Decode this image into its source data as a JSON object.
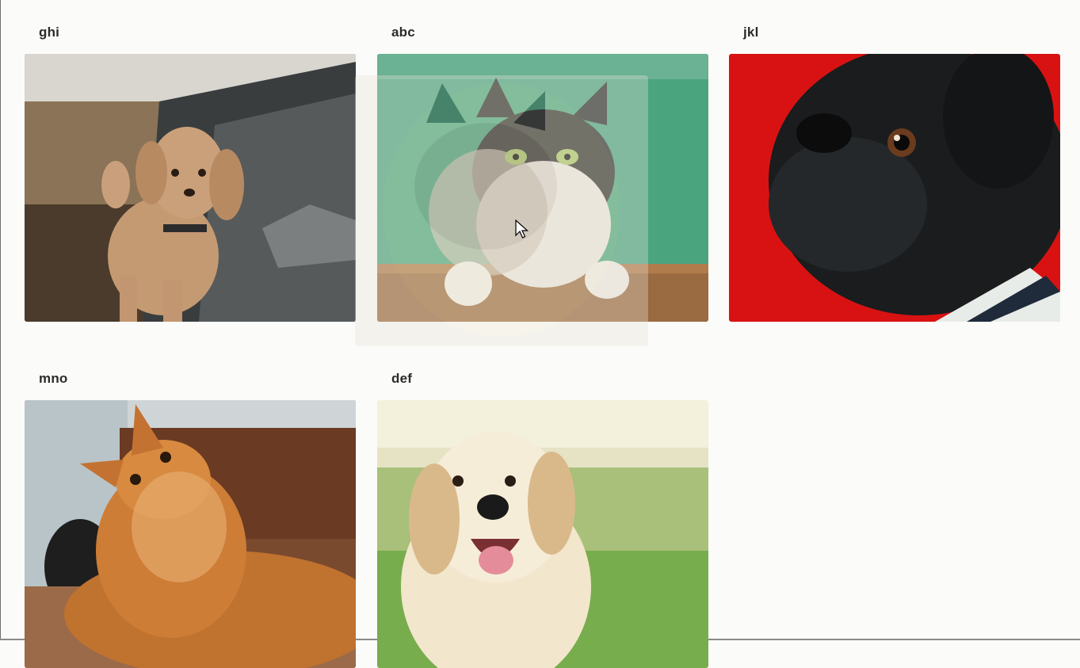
{
  "cards": [
    {
      "title": "ghi",
      "image_label": "ghi-image",
      "subject": "poodle-dog-photo"
    },
    {
      "title": "abc",
      "image_label": "abc-image",
      "subject": "cat-in-box-photo"
    },
    {
      "title": "jkl",
      "image_label": "jkl-image",
      "subject": "pug-dog-photo"
    },
    {
      "title": "mno",
      "image_label": "mno-image",
      "subject": "orange-cat-photo"
    },
    {
      "title": "def",
      "image_label": "def-image",
      "subject": "golden-retriever-photo"
    }
  ],
  "drag": {
    "state": "dragging",
    "subject": "cat-in-box-photo",
    "cursor_icon": "arrow-cursor-icon"
  }
}
